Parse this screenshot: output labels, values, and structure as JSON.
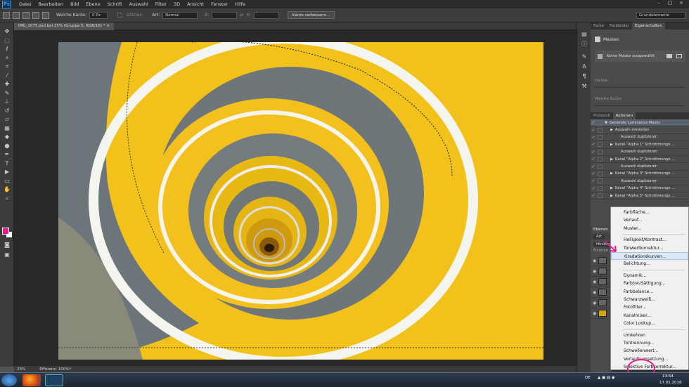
{
  "app": {
    "logo": "Ps"
  },
  "menu": [
    "Datei",
    "Bearbeiten",
    "Bild",
    "Ebene",
    "Schrift",
    "Auswahl",
    "Filter",
    "3D",
    "Ansicht",
    "Fenster",
    "Hilfe"
  ],
  "options": {
    "feather_label": "Weiche Kante:",
    "feather_value": "0 Px",
    "antialias_label": "Glätten",
    "style_label": "Art:",
    "style_value": "Normal",
    "width_label": "B:",
    "height_label": "H:",
    "refine_button": "Kante verbessern...",
    "workspace": "Grundelemente"
  },
  "document": {
    "tab_title": "IMG_1075.psd bei 25% (Gruppe 5, RGB/16) *",
    "zoom": "25%",
    "efficiency": "Effizienz: 100%*"
  },
  "properties": {
    "tabs": [
      "Farbe",
      "Farbfelder",
      "Eigenschaften"
    ],
    "title": "Masken",
    "no_mask": "Keine Maske ausgewählt",
    "density": "Dichte:",
    "feather": "Weiche Kante:"
  },
  "actions": {
    "tabs": [
      "Protokoll",
      "Aktionen"
    ],
    "rows": [
      "Generate Luminance Masks",
      "Auswahl einstellen",
      "Auswahl duplizieren",
      "Kanal \"Alpha 1\" Schnittmenge ...",
      "Auswahl duplizieren",
      "Kanal \"Alpha 2\" Schnittmenge ...",
      "Auswahl duplizieren",
      "Kanal \"Alpha 3\" Schnittmenge ...",
      "Auswahl duplizieren",
      "Kanal \"Alpha 4\" Schnittmenge ...",
      "Kanal \"Alpha 5\" Schnittmenge ..."
    ]
  },
  "layers": {
    "tab": "Ebenen",
    "kind": "Art",
    "blend": "Hindurch",
    "lock": "Fixieren:"
  },
  "context_menu": [
    "Farbfläche...",
    "Verlauf...",
    "Muster...",
    "Helligkeit/Kontrast...",
    "Tonwertkorrektur...",
    "Gradationskurven...",
    "Belichtung...",
    "Dynamik...",
    "Farbton/Sättigung...",
    "Farbbalance...",
    "Schwarzweiß...",
    "Fotofilter...",
    "Kanalmixer...",
    "Color Lookup...",
    "Umkehren",
    "Tontrennung...",
    "Schwellenwert...",
    "Verlaufsumsetzung...",
    "Selektive Farbkorrektur..."
  ],
  "taskbar": {
    "lang": "DE",
    "time": "13:54",
    "date": "17.01.2016"
  },
  "colors": {
    "accent_pink": "#e6198c",
    "stair_yellow": "#f3c319"
  }
}
